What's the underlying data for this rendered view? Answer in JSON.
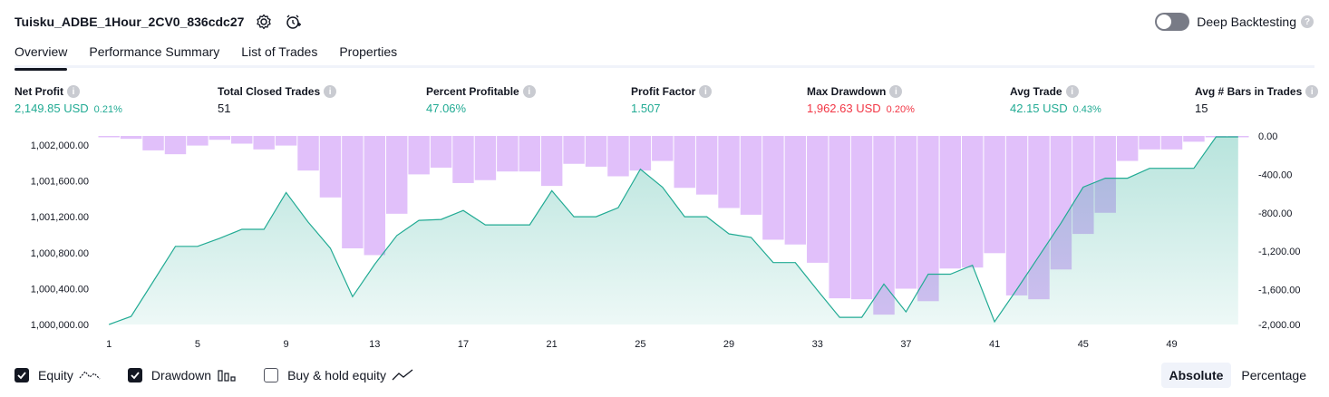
{
  "header": {
    "title": "Tuisku_ADBE_1Hour_2CV0_836cdc27",
    "deep_backtesting_label": "Deep Backtesting",
    "deep_backtesting_enabled": false,
    "icons": [
      "gear-icon",
      "alert-clock-icon",
      "help-icon"
    ]
  },
  "tabs": [
    {
      "label": "Overview",
      "active": true
    },
    {
      "label": "Performance Summary",
      "active": false
    },
    {
      "label": "List of Trades",
      "active": false
    },
    {
      "label": "Properties",
      "active": false
    }
  ],
  "metrics": {
    "net_profit": {
      "label": "Net Profit",
      "value": "2,149.85 USD",
      "pct": "0.21%"
    },
    "total_closed_trades": {
      "label": "Total Closed Trades",
      "value": "51"
    },
    "percent_profitable": {
      "label": "Percent Profitable",
      "value": "47.06%"
    },
    "profit_factor": {
      "label": "Profit Factor",
      "value": "1.507"
    },
    "max_drawdown": {
      "label": "Max Drawdown",
      "value": "1,962.63 USD",
      "pct": "0.20%"
    },
    "avg_trade": {
      "label": "Avg Trade",
      "value": "42.15 USD",
      "pct": "0.43%"
    },
    "avg_bars": {
      "label": "Avg # Bars in Trades",
      "value": "15"
    }
  },
  "colors": {
    "positive": "#22ab94",
    "negative": "#f23645",
    "equity_line": "#22ab94",
    "drawdown_bar": "#c88cf5"
  },
  "chart_data": {
    "type": "area",
    "x": [
      1,
      2,
      3,
      4,
      5,
      6,
      7,
      8,
      9,
      10,
      11,
      12,
      13,
      14,
      15,
      16,
      17,
      18,
      19,
      20,
      21,
      22,
      23,
      24,
      25,
      26,
      27,
      28,
      29,
      30,
      31,
      32,
      33,
      34,
      35,
      36,
      37,
      38,
      39,
      40,
      41,
      42,
      43,
      44,
      45,
      46,
      47,
      48,
      49,
      50,
      51,
      52
    ],
    "x_ticks": [
      "1",
      "5",
      "9",
      "13",
      "17",
      "21",
      "25",
      "29",
      "33",
      "37",
      "41",
      "45",
      "49"
    ],
    "left_axis": {
      "ticks": [
        "1,002,000.00",
        "1,001,600.00",
        "1,001,200.00",
        "1,000,800.00",
        "1,000,400.00",
        "1,000,000.00"
      ],
      "ylim": [
        1000000,
        1002100
      ]
    },
    "right_axis": {
      "ticks": [
        "0.00",
        "-400.00",
        "-800.00",
        "-1,200.00",
        "-1,600.00",
        "-2,000.00"
      ],
      "ylim": [
        -1962.63,
        0
      ]
    },
    "series": [
      {
        "name": "Equity",
        "values": [
          1000000,
          1000090,
          1000480,
          1000870,
          1000870,
          1000960,
          1001060,
          1001060,
          1001470,
          1001140,
          1000850,
          1000310,
          1000670,
          1000990,
          1001160,
          1001170,
          1001270,
          1001110,
          1001110,
          1001110,
          1001490,
          1001200,
          1001200,
          1001300,
          1001730,
          1001530,
          1001200,
          1001200,
          1001010,
          1000970,
          1000690,
          1000690,
          1000380,
          1000080,
          1000080,
          1000450,
          1000140,
          1000560,
          1000560,
          1000660,
          1000030,
          1000390,
          1000760,
          1001130,
          1001530,
          1001630,
          1001630,
          1001740,
          1001740,
          1001740,
          1002090,
          1002090
        ]
      },
      {
        "name": "Drawdown",
        "values": [
          0,
          -30,
          -150,
          -190,
          -100,
          -40,
          -80,
          -140,
          -100,
          -360,
          -640,
          -1170,
          -1240,
          -810,
          -400,
          -330,
          -490,
          -460,
          -370,
          -370,
          -520,
          -290,
          -320,
          -420,
          -360,
          -260,
          -540,
          -610,
          -750,
          -820,
          -1080,
          -1130,
          -1320,
          -1690,
          -1700,
          -1860,
          -1590,
          -1720,
          -1380,
          -1370,
          -1220,
          -1660,
          -1700,
          -1390,
          -1020,
          -800,
          -260,
          -140,
          -140,
          -60,
          0,
          0
        ]
      }
    ]
  },
  "legend": {
    "items": [
      {
        "label": "Equity",
        "checked": true,
        "icon": "equity-line-icon"
      },
      {
        "label": "Drawdown",
        "checked": true,
        "icon": "drawdown-bars-icon"
      },
      {
        "label": "Buy & hold equity",
        "checked": false,
        "icon": "buy-hold-line-icon"
      }
    ]
  },
  "modes": [
    {
      "label": "Absolute",
      "active": true
    },
    {
      "label": "Percentage",
      "active": false
    }
  ]
}
